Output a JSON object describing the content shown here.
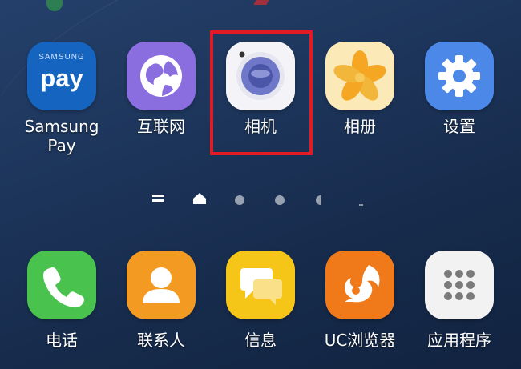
{
  "home_screen": {
    "top_row": [
      {
        "label_line1": "Samsung",
        "label_line2": "Pay",
        "icon": "samsung-pay-icon",
        "icon_text_small": "SAMSUNG",
        "icon_text_big": "pay",
        "color": "#1565c0"
      },
      {
        "label": "互联网",
        "icon": "internet-globe-icon",
        "color": "#8a6ddf"
      },
      {
        "label": "相机",
        "icon": "camera-icon",
        "color": "#f4f4f8",
        "highlighted": true
      },
      {
        "label": "相册",
        "icon": "gallery-flower-icon",
        "color": "#fbe9b8"
      },
      {
        "label": "设置",
        "icon": "settings-gear-icon",
        "color": "#4b88e8"
      }
    ],
    "page_indicator": {
      "items": [
        "menu-icon",
        "home-icon",
        "dot",
        "dot",
        "dot"
      ],
      "active": "home"
    },
    "dock": [
      {
        "label": "电话",
        "icon": "phone-icon",
        "color": "#49c24e"
      },
      {
        "label": "联系人",
        "icon": "contacts-person-icon",
        "color": "#f39a23"
      },
      {
        "label": "信息",
        "icon": "messages-bubble-icon",
        "color": "#f5c518"
      },
      {
        "label": "UC浏览器",
        "icon": "uc-browser-squirrel-icon",
        "color": "#f07a1a"
      },
      {
        "label": "应用程序",
        "icon": "apps-grid-icon",
        "color": "#f2f2f2"
      }
    ],
    "highlight_color": "#e01b24"
  }
}
